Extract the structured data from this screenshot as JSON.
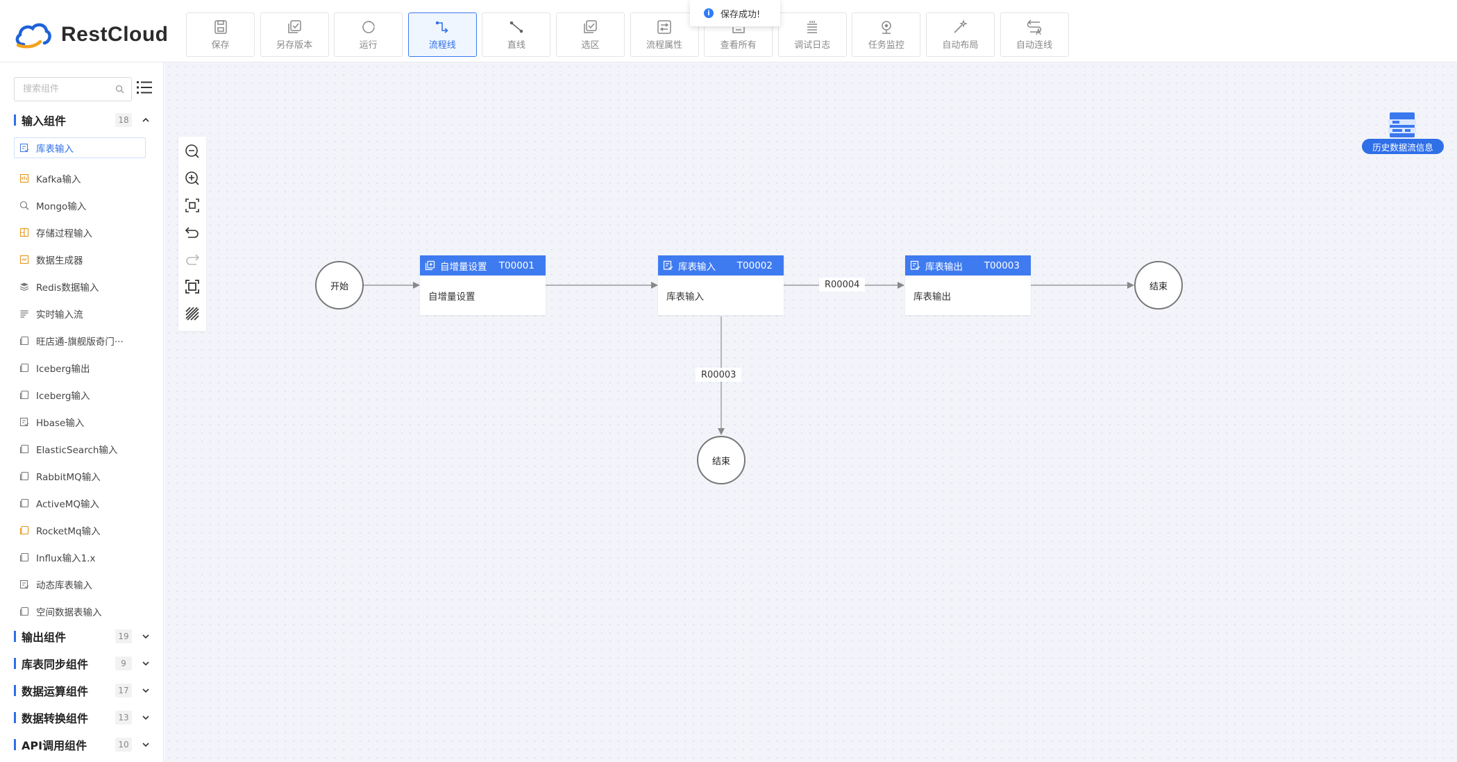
{
  "app": {
    "name": "RestCloud"
  },
  "toast": {
    "message": "保存成功!"
  },
  "toolbar": [
    {
      "label": "保存",
      "icon": "save-icon"
    },
    {
      "label": "另存版本",
      "icon": "save-version-icon"
    },
    {
      "label": "运行",
      "icon": "run-icon"
    },
    {
      "label": "流程线",
      "icon": "flow-line-icon",
      "active": true
    },
    {
      "label": "直线",
      "icon": "straight-line-icon"
    },
    {
      "label": "选区",
      "icon": "selection-icon"
    },
    {
      "label": "流程属性",
      "icon": "flow-properties-icon"
    },
    {
      "label": "查看所有",
      "icon": "view-all-icon"
    },
    {
      "label": "调试日志",
      "icon": "debug-log-icon"
    },
    {
      "label": "任务监控",
      "icon": "task-monitor-icon"
    },
    {
      "label": "自动布局",
      "icon": "auto-layout-icon"
    },
    {
      "label": "自动连线",
      "icon": "auto-connect-icon"
    }
  ],
  "sidebar": {
    "search_placeholder": "搜索组件",
    "groups": [
      {
        "name": "输入组件",
        "count": "18",
        "expanded": true
      },
      {
        "name": "输出组件",
        "count": "19"
      },
      {
        "name": "库表同步组件",
        "count": "9"
      },
      {
        "name": "数据运算组件",
        "count": "17"
      },
      {
        "name": "数据转换组件",
        "count": "13"
      },
      {
        "name": "API调用组件",
        "count": "10"
      }
    ],
    "input_items": [
      "库表输入",
      "Kafka输入",
      "Mongo输入",
      "存储过程输入",
      "数据生成器",
      "Redis数据输入",
      "实时输入流",
      "旺店通-旗舰版奇门···",
      "Iceberg输出",
      "Iceberg输入",
      "Hbase输入",
      "ElasticSearch输入",
      "RabbitMQ输入",
      "ActiveMQ输入",
      "RocketMq输入",
      "Influx输入1.x",
      "动态库表输入",
      "空间数据表输入"
    ]
  },
  "flow": {
    "start": "开始",
    "end_1": "结束",
    "end_2": "结束",
    "tasks": [
      {
        "title": "自增量设置",
        "id": "T00001",
        "body": "自增量设置"
      },
      {
        "title": "库表输入",
        "id": "T00002",
        "body": "库表输入"
      },
      {
        "title": "库表输出",
        "id": "T00003",
        "body": "库表输出"
      }
    ],
    "edge_labels": {
      "r4": "R00004",
      "r3": "R00003"
    }
  },
  "history_button": "历史数据流信息",
  "colors": {
    "accent": "#3f7bf0",
    "canvas": "#f2f4fa"
  }
}
